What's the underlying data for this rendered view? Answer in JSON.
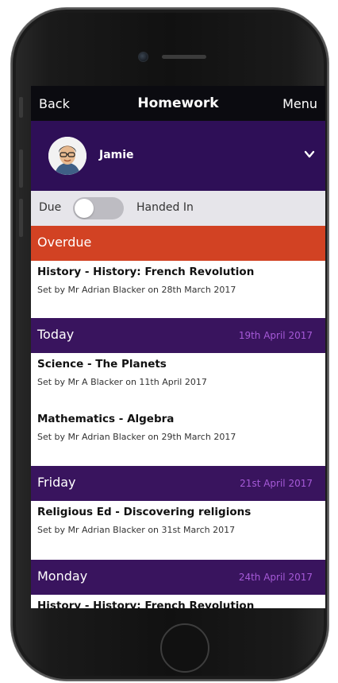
{
  "navbar": {
    "back": "Back",
    "title": "Homework",
    "menu": "Menu"
  },
  "user": {
    "name": "Jamie"
  },
  "toggle": {
    "left_label": "Due",
    "right_label": "Handed In",
    "state": "Due"
  },
  "sections": [
    {
      "title": "Overdue",
      "date": "",
      "color": "#d24223",
      "items": [
        {
          "title": "History - History: French Revolution",
          "subtitle": "Set by Mr Adrian Blacker on 28th March 2017"
        }
      ]
    },
    {
      "title": "Today",
      "date": "19th April 2017",
      "color": "#39145e",
      "items": [
        {
          "title": "Science - The Planets",
          "subtitle": "Set by Mr A Blacker on 11th April 2017"
        },
        {
          "title": "Mathematics - Algebra",
          "subtitle": "Set by Mr Adrian Blacker on 29th March 2017"
        }
      ]
    },
    {
      "title": "Friday",
      "date": "21st April 2017",
      "color": "#39145e",
      "items": [
        {
          "title": "Religious Ed - Discovering religions",
          "subtitle": "Set by Mr Adrian Blacker on 31st March 2017"
        }
      ]
    },
    {
      "title": "Monday",
      "date": "24th April 2017",
      "color": "#39145e",
      "items": [
        {
          "title": "History - History: French Revolution",
          "subtitle": ""
        }
      ]
    }
  ],
  "colors": {
    "header_purple": "#2e0f57",
    "section_purple": "#39145e",
    "overdue": "#d24223",
    "date_text": "#a65ad8"
  },
  "icons": {
    "dropdown": "chevron-down-icon",
    "avatar": "avatar",
    "camera": "camera-icon",
    "home": "home-button"
  }
}
